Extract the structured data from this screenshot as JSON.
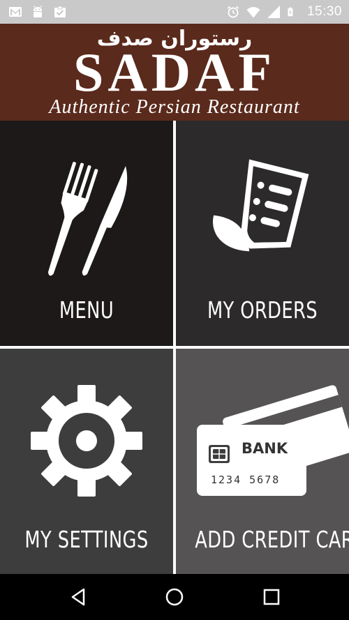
{
  "status_bar": {
    "time": "15:30",
    "icons": [
      "gmail-icon",
      "android-icon",
      "clipboard-check-icon",
      "alarm-icon",
      "wifi-icon",
      "signal-icon",
      "battery-charging-icon"
    ]
  },
  "header": {
    "arabic_name": "رستوران صدف",
    "brand": "SADAF",
    "tagline": "Authentic Persian Restaurant",
    "background_color": "#5a2a1c"
  },
  "tiles": [
    {
      "id": "menu",
      "label": "MENU",
      "icon": "fork-knife-icon",
      "color": "#1c1918"
    },
    {
      "id": "orders",
      "label": "MY ORDERS",
      "icon": "receipt-icon",
      "color": "#2c2a2a"
    },
    {
      "id": "settings",
      "label": "MY SETTINGS",
      "icon": "gear-icon",
      "color": "#3e3d3d"
    },
    {
      "id": "card",
      "label": "ADD CREDIT CARD",
      "icon": "credit-card-icon",
      "color": "#555354",
      "card_bank_text": "BANK",
      "card_number_text": "1234 5678"
    }
  ],
  "nav_bar": {
    "buttons": [
      "back-icon",
      "home-icon",
      "recent-apps-icon"
    ]
  }
}
